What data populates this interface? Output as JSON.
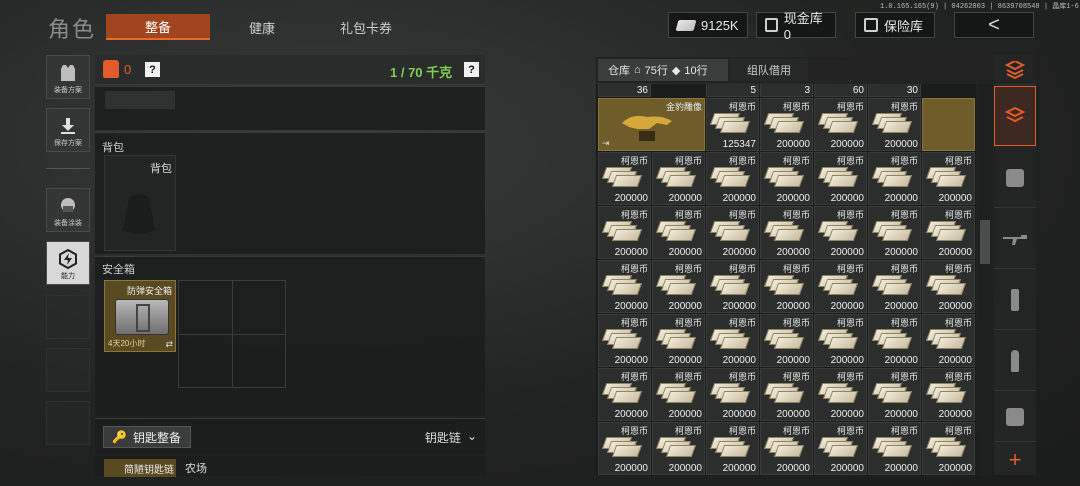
{
  "version": "1.0.165.165(9) | 04262003 | 8639708548 | 晶库1-6",
  "title": "角色",
  "tabs": [
    {
      "label": "整备",
      "active": true
    },
    {
      "label": "健康",
      "active": false
    },
    {
      "label": "礼包卡券",
      "active": false
    }
  ],
  "resources": {
    "currency": "9125K",
    "cash_vault": "现金库 0",
    "insurance": "保险库",
    "back_symbol": "<"
  },
  "sidebar": [
    {
      "label": "装备方案",
      "icon": "vest-icon"
    },
    {
      "label": "保存方案",
      "icon": "download-icon"
    },
    {
      "label": "装备涂装",
      "icon": "helmet-icon"
    },
    {
      "label": "能力",
      "icon": "ability-icon",
      "active": true
    }
  ],
  "loadout": {
    "weight": "0",
    "capacity": "1 / 70 千克",
    "help": "?"
  },
  "backpack": {
    "section_label": "背包",
    "slot_label": "背包"
  },
  "safebox": {
    "section_label": "安全箱",
    "item_name": "防弹安全箱",
    "time_left": "4天20小时"
  },
  "keychain": {
    "button_label": "钥匙整备",
    "dropdown_label": "钥匙链",
    "item_label": "简陋钥匙链",
    "item_label2": "农场"
  },
  "warehouse": {
    "tab_label": "仓库",
    "rows": "75行",
    "rows2": "10行",
    "team_tab": "组队借用",
    "top_counts": [
      "36",
      "5",
      "3",
      "60",
      "30"
    ],
    "special_item": {
      "name": "金豹雕像"
    },
    "coin_name": "柯恩币",
    "first_row_counts": [
      "125347",
      "200000",
      "200000",
      "200000"
    ],
    "coin_count": "200000"
  }
}
